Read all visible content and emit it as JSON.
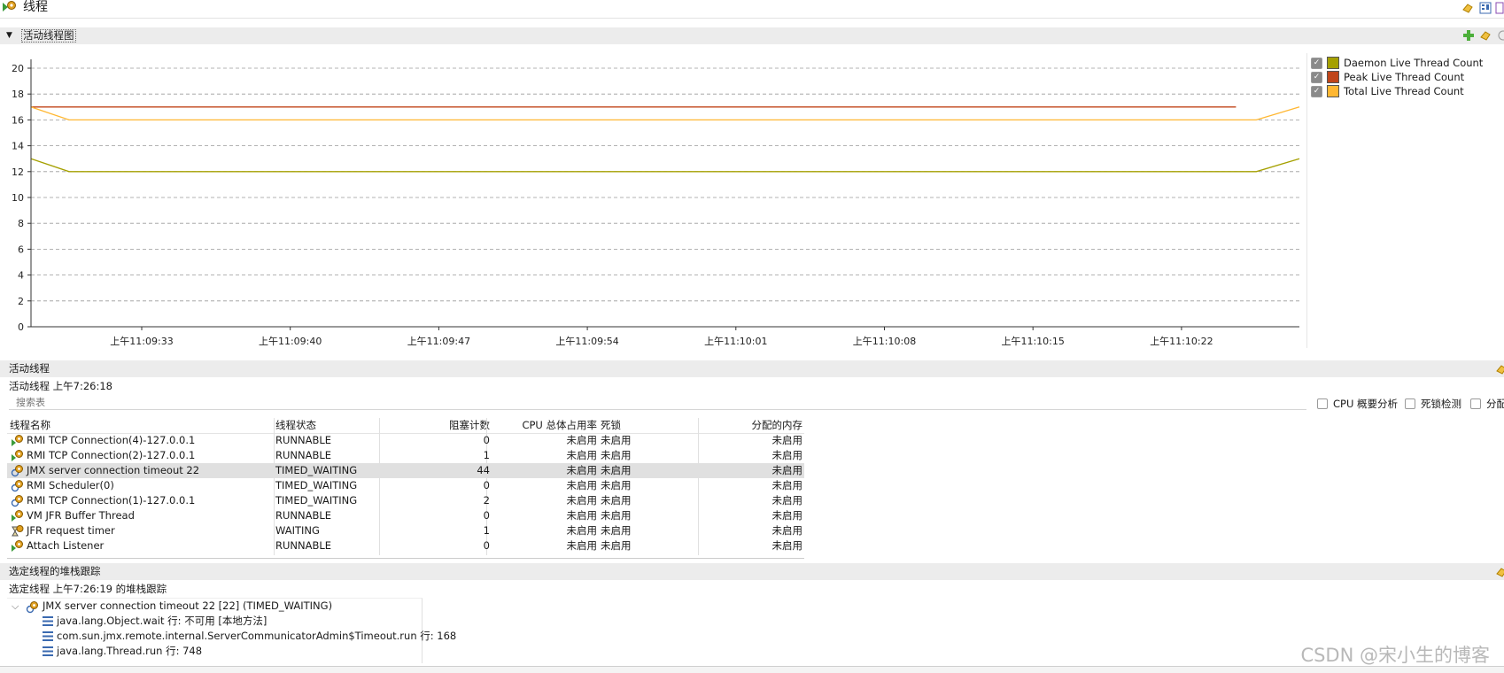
{
  "window": {
    "title": "线程"
  },
  "chart_section": {
    "title": "活动线程图"
  },
  "chart_data": {
    "type": "line",
    "y_ticks": [
      "0",
      "2",
      "4",
      "6",
      "8",
      "10",
      "12",
      "14",
      "16",
      "18",
      "20"
    ],
    "x_ticks": [
      "上午11:09:33",
      "上午11:09:40",
      "上午11:09:47",
      "上午11:09:54",
      "上午11:10:01",
      "上午11:10:08",
      "上午11:10:15",
      "上午11:10:22"
    ],
    "ylim": [
      0,
      20
    ],
    "grid": true,
    "legend_position": "right",
    "series": [
      {
        "name": "Daemon Live Thread Count",
        "color": "#a5a000",
        "x": [
          0,
          0.03,
          0.966,
          1.0
        ],
        "values": [
          13,
          12,
          12,
          13
        ]
      },
      {
        "name": "Peak Live Thread Count",
        "color": "#c0451a",
        "x": [
          0,
          0.95
        ],
        "values": [
          17,
          17
        ]
      },
      {
        "name": "Total Live Thread Count",
        "color": "#ffb732",
        "x": [
          0,
          0.03,
          0.966,
          1.0
        ],
        "values": [
          17,
          16,
          16,
          17
        ]
      }
    ]
  },
  "legend": [
    {
      "label": "Daemon Live Thread Count",
      "color": "#a5a000",
      "checked": true
    },
    {
      "label": "Peak Live Thread Count",
      "color": "#c0451a",
      "checked": true
    },
    {
      "label": "Total Live Thread Count",
      "color": "#ffb732",
      "checked": true
    }
  ],
  "threads_section": {
    "title": "活动线程",
    "timestamp": "活动线程 上午7:26:18",
    "search_placeholder": "搜索表",
    "options": [
      "CPU 概要分析",
      "死锁检测",
      "分配"
    ],
    "columns": [
      "线程名称",
      "线程状态",
      "阻塞计数",
      "CPU 总体占用率",
      "死锁",
      "分配的内存"
    ],
    "rows": [
      {
        "name": "RMI TCP Connection(4)-127.0.0.1",
        "state": "RUNNABLE",
        "blocked": "0",
        "cpu": "未启用",
        "deadlock": "未启用",
        "memory": "未启用",
        "icon": "thread-running-icon"
      },
      {
        "name": "RMI TCP Connection(2)-127.0.0.1",
        "state": "RUNNABLE",
        "blocked": "1",
        "cpu": "未启用",
        "deadlock": "未启用",
        "memory": "未启用",
        "icon": "thread-running-icon"
      },
      {
        "name": "JMX server connection timeout 22",
        "state": "TIMED_WAITING",
        "blocked": "44",
        "cpu": "未启用",
        "deadlock": "未启用",
        "memory": "未启用",
        "icon": "thread-waiting-icon",
        "selected": true
      },
      {
        "name": "RMI Scheduler(0)",
        "state": "TIMED_WAITING",
        "blocked": "0",
        "cpu": "未启用",
        "deadlock": "未启用",
        "memory": "未启用",
        "icon": "thread-waiting-icon"
      },
      {
        "name": "RMI TCP Connection(1)-127.0.0.1",
        "state": "TIMED_WAITING",
        "blocked": "2",
        "cpu": "未启用",
        "deadlock": "未启用",
        "memory": "未启用",
        "icon": "thread-waiting-icon"
      },
      {
        "name": "VM JFR Buffer Thread",
        "state": "RUNNABLE",
        "blocked": "0",
        "cpu": "未启用",
        "deadlock": "未启用",
        "memory": "未启用",
        "icon": "thread-running-icon"
      },
      {
        "name": "JFR request timer",
        "state": "WAITING",
        "blocked": "1",
        "cpu": "未启用",
        "deadlock": "未启用",
        "memory": "未启用",
        "icon": "hourglass-icon"
      },
      {
        "name": "Attach Listener",
        "state": "RUNNABLE",
        "blocked": "0",
        "cpu": "未启用",
        "deadlock": "未启用",
        "memory": "未启用",
        "icon": "thread-running-icon"
      }
    ]
  },
  "stack_section": {
    "title": "选定线程的堆栈跟踪",
    "timestamp": "选定线程 上午7:26:19 的堆栈跟踪",
    "thread": "JMX server connection timeout 22 [22] (TIMED_WAITING)",
    "frames": [
      "java.lang.Object.wait 行: 不可用 [本地方法]",
      "com.sun.jmx.remote.internal.ServerCommunicatorAdmin$Timeout.run 行: 168",
      "java.lang.Thread.run 行: 748"
    ]
  },
  "watermark": "CSDN @宋小生的博客"
}
